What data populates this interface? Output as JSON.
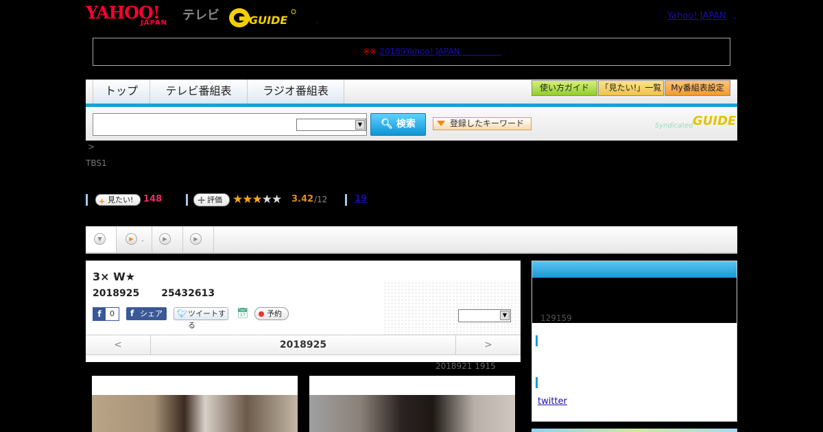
{
  "header": {
    "logo_yahoo": "YAHOO!",
    "logo_japan": "JAPAN",
    "logo_tv": "テレビ",
    "logo_gguide": "GUIDE",
    "link_yahoo_japan": "Yahoo! JAPAN",
    "link_sep": ",",
    "link_sep2": ","
  },
  "notice": {
    "mark": "※※",
    "link_text": "20189Yahoo! JAPAN　　　　　"
  },
  "nav": {
    "tabs": [
      "トップ",
      "テレビ番組表",
      "ラジオ番組表"
    ],
    "buttons": [
      "使い方ガイド",
      "「見たい!」一覧",
      "My番組表設定"
    ]
  },
  "search": {
    "input_value": "",
    "select_value": "",
    "button_label": "検索",
    "keyword_button": "登録したキーワード",
    "syndicated": "Syndicated",
    "syndicated_g": "GUIDE"
  },
  "breadcrumb": ">",
  "channel": "TBS1",
  "stats": {
    "mitai_label": "見たい!",
    "mitai_count": "148",
    "hyoka_label": "評価",
    "stars_on": "★★★",
    "stars_off": "★★",
    "rating": "3.42",
    "rating_count": "/12",
    "review_count": "19"
  },
  "tabrow": {
    "tab2_label": "."
  },
  "program": {
    "title": "3× W★",
    "date": "2018925",
    "code": "25432613",
    "fb_like_count": "0",
    "fb_share": "シェア",
    "tweet": "ツイートする",
    "reserve": "予約",
    "select_value": "",
    "pager_prev": "<",
    "pager_date": "2018925",
    "pager_next": ">"
  },
  "update_info": "2018921  1915",
  "sidebar": {
    "count": "129159",
    "twitter_link": "twitter"
  },
  "colors": {
    "accent_blue": "#1aa0d6",
    "yahoo_red": "#ff0033",
    "mitai_pink": "#ee2a62",
    "rating_orange": "#e58a1e"
  }
}
